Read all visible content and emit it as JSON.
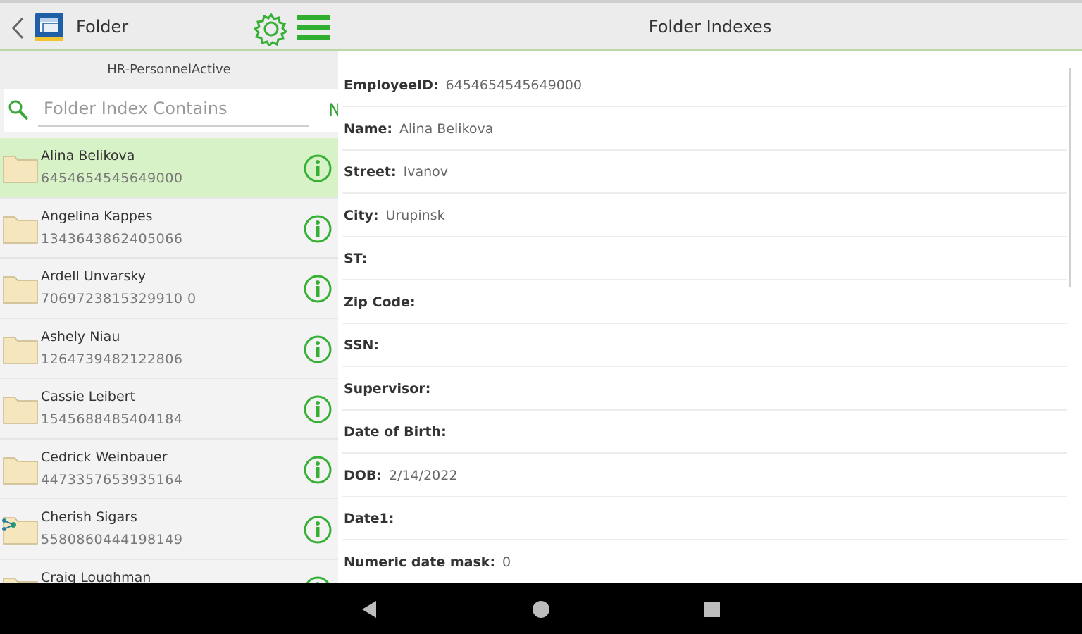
{
  "header": {
    "left_title": "Folder",
    "right_title": "Folder Indexes"
  },
  "sidebar": {
    "folder_name": "HR-PersonnelActive",
    "search_placeholder": "Folder Index Contains",
    "new_label": "N",
    "items": [
      {
        "name": "Alina Belikova",
        "number": "6454654545649000",
        "selected": true
      },
      {
        "name": "Angelina Kappes",
        "number": "1343643862405066"
      },
      {
        "name": "Ardell Unvarsky",
        "number": "7069723815329910 0"
      },
      {
        "name": "Ashely Niau",
        "number": "1264739482122806"
      },
      {
        "name": "Cassie Leibert",
        "number": "1545688485404184"
      },
      {
        "name": "Cedrick Weinbauer",
        "number": "4473357653935164"
      },
      {
        "name": "Cherish Sigars",
        "number": "5580860444198149",
        "shared": true
      },
      {
        "name": "Craig Loughman",
        "number": ""
      }
    ]
  },
  "detail": {
    "fields": [
      {
        "label": "EmployeeID:",
        "value": "6454654545649000"
      },
      {
        "label": "Name:",
        "value": "Alina Belikova"
      },
      {
        "label": "Street:",
        "value": "Ivanov"
      },
      {
        "label": "City:",
        "value": "Urupinsk"
      },
      {
        "label": "ST:",
        "value": ""
      },
      {
        "label": "Zip Code:",
        "value": ""
      },
      {
        "label": "SSN:",
        "value": ""
      },
      {
        "label": "Supervisor:",
        "value": ""
      },
      {
        "label": "Date of Birth:",
        "value": ""
      },
      {
        "label": "DOB:",
        "value": "2/14/2022"
      },
      {
        "label": "Date1:",
        "value": ""
      },
      {
        "label": "Numeric date mask:",
        "value": "0"
      }
    ]
  },
  "colors": {
    "accent": "#2f9e2f",
    "selected_row": "#d8f2c7"
  }
}
